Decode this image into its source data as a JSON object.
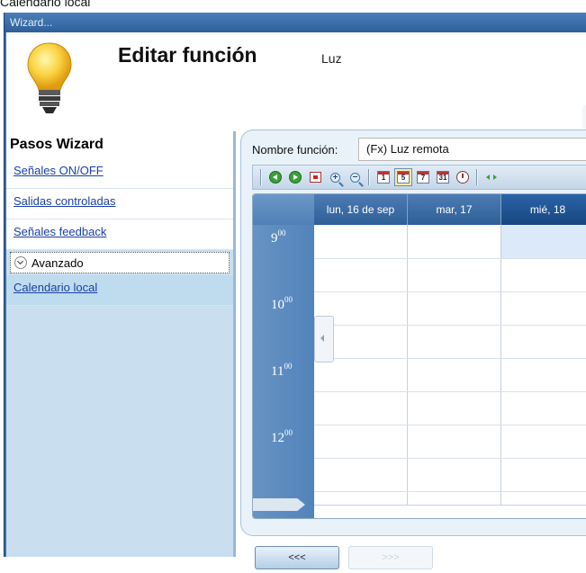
{
  "document": {
    "caption": "Calendario local"
  },
  "window": {
    "title": "Wizard..."
  },
  "header": {
    "title": "Editar función",
    "subtitle": "Luz"
  },
  "sidebar": {
    "heading": "Pasos Wizard",
    "items": [
      {
        "label": "Señales ON/OFF"
      },
      {
        "label": "Salidas controladas"
      },
      {
        "label": "Señales feedback"
      }
    ],
    "group_label": "Avanzado",
    "active_item": {
      "label": "Calendario local"
    }
  },
  "form": {
    "name_label": "Nombre función:",
    "name_value": "(Fx) Luz remota"
  },
  "toolbar": {
    "icons": [
      "previous-icon",
      "next-icon",
      "today-icon",
      "zoom-in-icon",
      "zoom-out-icon",
      "day-view-icon",
      "work-week-view-icon",
      "week-view-icon",
      "month-view-icon",
      "timeline-view-icon",
      "fit-icon"
    ],
    "day_view": "1",
    "work_week_view": "5",
    "week_view": "7",
    "month_view": "31",
    "selected_view": "work-week"
  },
  "calendar": {
    "days": [
      "lun, 16 de sep",
      "mar, 17",
      "mié, 18"
    ],
    "highlighted_day": "mié, 18",
    "hours": [
      {
        "h": "9",
        "m": "00"
      },
      {
        "h": "10",
        "m": "00"
      },
      {
        "h": "11",
        "m": "00"
      },
      {
        "h": "12",
        "m": "00"
      }
    ]
  },
  "footer": {
    "back_label": "<<<",
    "next_label": ">>>"
  }
}
